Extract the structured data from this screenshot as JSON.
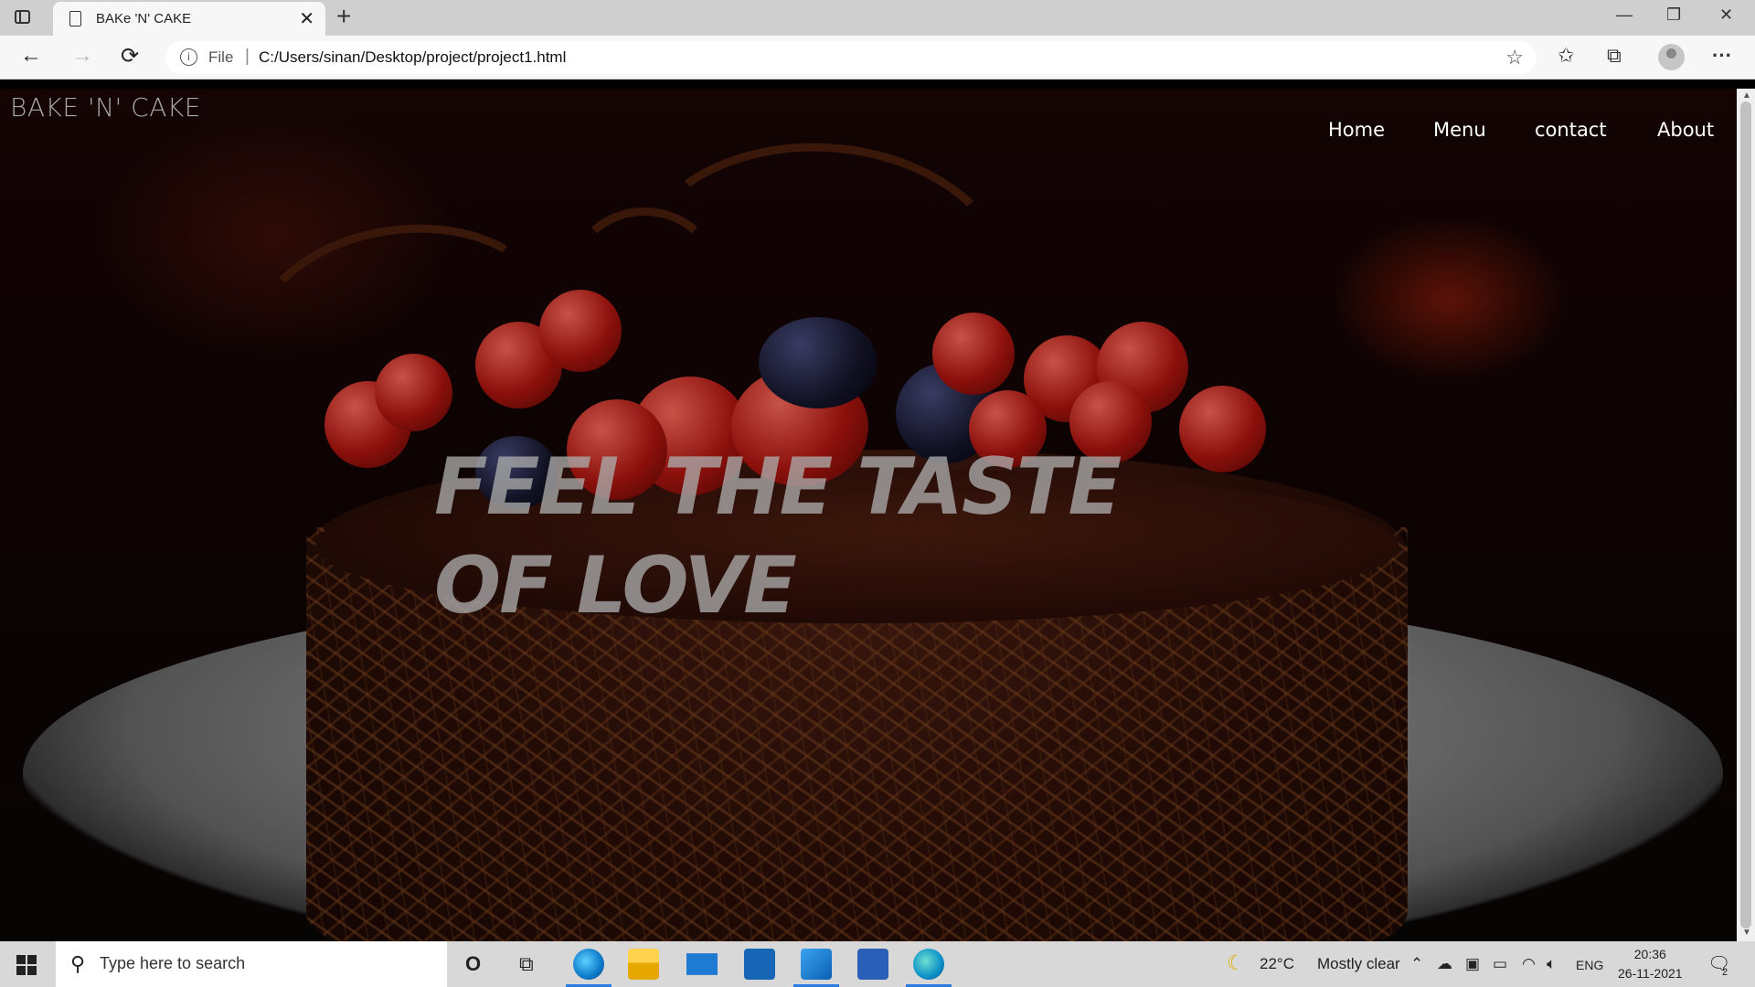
{
  "browser": {
    "tab_title": "BAKe 'N' CAKE",
    "tab_close": "✕",
    "new_tab": "+",
    "window_controls": {
      "minimize": "—",
      "restore": "❐",
      "close": "✕"
    },
    "nav": {
      "back": "←",
      "forward": "→",
      "refresh": "⟳"
    },
    "address": {
      "info_icon": "i",
      "scheme_label": "File",
      "separator": "|",
      "url": "C:/Users/sinan/Desktop/project/project1.html",
      "favorite_icon": "☆"
    },
    "toolbar": {
      "favorites_icon": "✩",
      "collections_icon": "⧉",
      "more_icon": "···"
    }
  },
  "page": {
    "brand": "BAKE 'N' CAKE",
    "nav_links": [
      "Home",
      "Menu",
      "contact",
      "About"
    ],
    "headline": "FEEL THE TASTE OF LOVE",
    "colors": {
      "brand_text": "#a8a8a8",
      "nav_text": "#ffffff",
      "headline_text": "#aaaaaa"
    }
  },
  "scrollbar": {
    "up": "▲",
    "down": "▼"
  },
  "taskbar": {
    "search_icon": "⚲",
    "search_placeholder": "Type here to search",
    "cortana_icon": "O",
    "taskview_icon": "⧉",
    "apps": [
      "edge",
      "file-explorer",
      "mail",
      "dell-app",
      "vscode",
      "word",
      "edge-active"
    ],
    "weather": {
      "icon": "☾",
      "temp": "22°C",
      "text": "Mostly clear"
    },
    "tray": {
      "chevron": "⌃",
      "lang": "ENG",
      "notifications": "2"
    },
    "time": "20:36",
    "date": "26-11-2021"
  }
}
